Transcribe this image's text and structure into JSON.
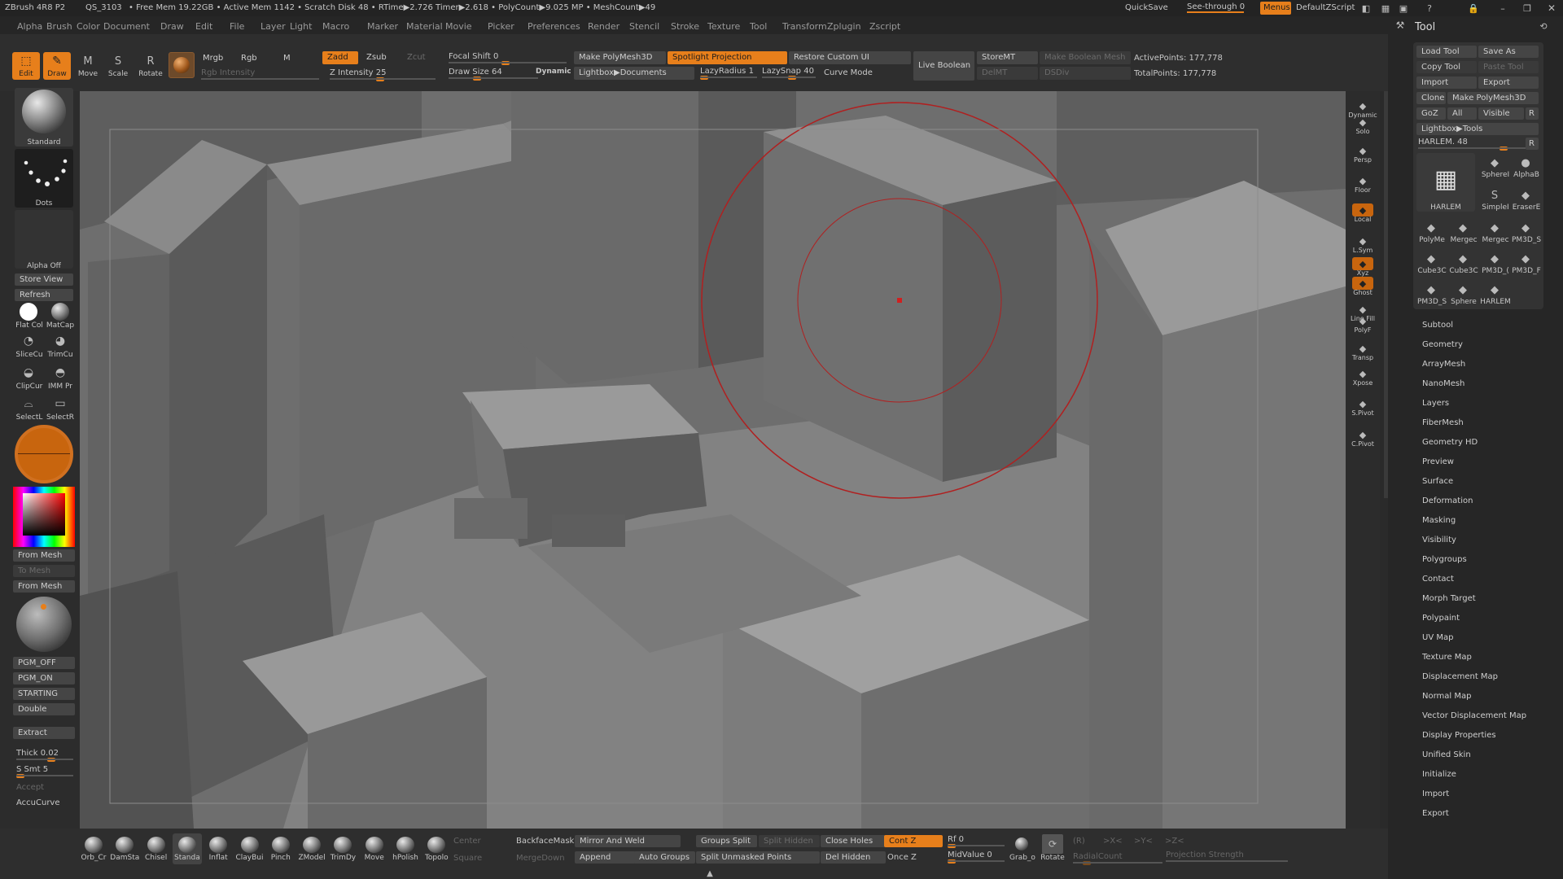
{
  "topbar": {
    "app": "ZBrush 4R8 P2",
    "qs": "QS_3103",
    "stats": "• Free Mem 19.22GB • Active Mem 1142 • Scratch Disk 48 • RTime▶2.726 Timer▶2.618 • PolyCount▶9.025 MP • MeshCount▶49",
    "quicksave": "QuickSave",
    "seethrough": "See-through  0",
    "menus": "Menus",
    "zscript": "DefaultZScript"
  },
  "menubar": [
    "Alpha",
    "Brush",
    "Color",
    "Document",
    "Draw",
    "Edit",
    "File",
    "Layer",
    "Light",
    "Macro",
    "Marker",
    "Material",
    "Movie",
    "Picker",
    "Preferences",
    "Render",
    "Stencil",
    "Stroke",
    "Texture",
    "Tool",
    "Transform",
    "Zplugin",
    "Zscript"
  ],
  "shelf": {
    "edit": "Edit",
    "draw": "Draw",
    "move": "Move",
    "scale": "Scale",
    "rotate": "Rotate",
    "mrgb": "Mrgb",
    "rgb": "Rgb",
    "m": "M",
    "rgb_intensity": "Rgb Intensity",
    "zadd": "Zadd",
    "zsub": "Zsub",
    "zcut": "Zcut",
    "z_intensity": "Z Intensity 25",
    "focal_shift": "Focal Shift 0",
    "draw_size": "Draw Size 64",
    "dynamic": "Dynamic",
    "make_polymesh": "Make PolyMesh3D",
    "spotlight": "Spotlight Projection",
    "restore_ui": "Restore Custom UI",
    "lightbox_docs": "Lightbox▶Documents",
    "lazy_radius": "LazyRadius 1",
    "lazy_snap": "LazySnap 40",
    "curve_mode": "Curve Mode",
    "live_boolean": "Live Boolean",
    "storemt": "StoreMT",
    "delmt": "DelMT",
    "make_boolean": "Make Boolean Mesh",
    "dsdiv": "DSDiv",
    "active_points": "ActivePoints: 177,778",
    "total_points": "TotalPoints: 177,778"
  },
  "leftpanel": {
    "brush": "Standard",
    "stroke": "Dots",
    "alpha": "Alpha Off",
    "store_view": "Store View",
    "refresh": "Refresh",
    "flat_color": "Flat Col",
    "matcap": "MatCap",
    "slicecu": "SliceCu",
    "trimcu": "TrimCu",
    "clipcur": "ClipCur",
    "imm": "IMM Pr",
    "selectl": "SelectL",
    "selectr": "SelectR",
    "from_mesh": "From Mesh",
    "to_mesh": "To Mesh",
    "from_mesh2": "From Mesh",
    "pgm_off": "PGM_OFF",
    "pgm_on": "PGM_ON",
    "starting": "STARTING",
    "double": "Double",
    "extract": "Extract",
    "thick": "Thick 0.02",
    "ssmt": "S Smt 5",
    "accept": "Accept",
    "accucurve": "AccuCurve"
  },
  "rightshelf": [
    "Dynamic",
    "Solo",
    "Persp",
    "Floor",
    "Local",
    "L.Sym",
    "Xyz",
    "Ghost",
    "Line Fill",
    "PolyF",
    "Transp",
    "Xpose",
    "S.Pivot",
    "C.Pivot"
  ],
  "toolpanel": {
    "title": "Tool",
    "load_tool": "Load Tool",
    "save_as": "Save As",
    "copy_tool": "Copy Tool",
    "paste_tool": "Paste Tool",
    "import": "Import",
    "export": "Export",
    "clone": "Clone",
    "make_polymesh": "Make PolyMesh3D",
    "goz": "GoZ",
    "all": "All",
    "visible": "Visible",
    "r": "R",
    "lightbox_tools": "Lightbox▶Tools",
    "harlem": "HARLEM. 48",
    "current": "HARLEM",
    "thumbs": [
      "SphereI",
      "AlphaB",
      "SimpleI",
      "EraserE",
      "PolyMe",
      "Mergec",
      "Mergec",
      "PM3D_S",
      "Cube3C",
      "Cube3C",
      "PM3D_(",
      "PM3D_F",
      "PM3D_S",
      "Sphere",
      "HARLEM"
    ],
    "sections": [
      "Subtool",
      "Geometry",
      "ArrayMesh",
      "NanoMesh",
      "Layers",
      "FiberMesh",
      "Geometry HD",
      "Preview",
      "Surface",
      "Deformation",
      "Masking",
      "Visibility",
      "Polygroups",
      "Contact",
      "Morph Target",
      "Polypaint",
      "UV Map",
      "Texture Map",
      "Displacement Map",
      "Normal Map",
      "Vector Displacement Map",
      "Display Properties",
      "Unified Skin",
      "Initialize",
      "Import",
      "Export"
    ]
  },
  "bottom": {
    "brushes": [
      "Orb_Cr",
      "DamSta",
      "Chisel",
      "Standa",
      "Inflat",
      "ClayBui",
      "Pinch",
      "ZModel",
      "TrimDy",
      "Move",
      "hPolish",
      "Topolo"
    ],
    "center": "Center",
    "square": "Square",
    "backface": "BackfaceMask",
    "mirror_weld": "Mirror And Weld",
    "mergedown": "MergeDown",
    "append": "Append",
    "groups_split": "Groups Split",
    "split_hidden": "Split Hidden",
    "auto_groups": "Auto Groups",
    "split_unmasked": "Split Unmasked Points",
    "close_holes": "Close Holes",
    "del_hidden": "Del Hidden",
    "cont_z": "Cont Z",
    "once_z": "Once Z",
    "rf": "Rf 0",
    "midvalue": "MidValue 0",
    "grab": "Grab_o",
    "rotate": "Rotate",
    "r": "(R)",
    "xc": ">X<",
    "yc": ">Y<",
    "zc": ">Z<",
    "radial": "RadialCount",
    "projection": "Projection Strength"
  }
}
